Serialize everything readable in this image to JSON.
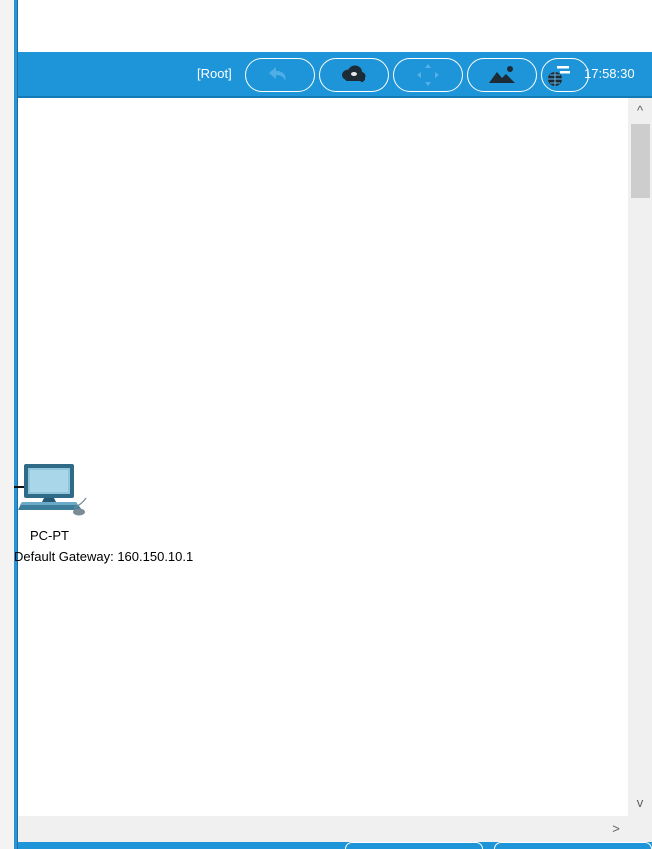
{
  "toolbar": {
    "root_label": "[Root]",
    "time": "17:58:30",
    "buttons": [
      {
        "name": "back",
        "icon": "back-arrow-icon"
      },
      {
        "name": "new-cluster",
        "icon": "cloud-add-icon"
      },
      {
        "name": "move-object",
        "icon": "move-arrows-icon"
      },
      {
        "name": "set-background",
        "icon": "landscape-image-icon"
      },
      {
        "name": "viewport",
        "icon": "globe-network-icon"
      }
    ]
  },
  "canvas": {
    "device": {
      "model": "PC-PT",
      "annotation": "Default Gateway: 160.150.10.1"
    }
  },
  "scrollbars": {
    "up_arrow": "^",
    "down_arrow": "v",
    "right_arrow": ">"
  },
  "colors": {
    "toolbar": "#1e95d8",
    "border": "#2a93d5"
  }
}
